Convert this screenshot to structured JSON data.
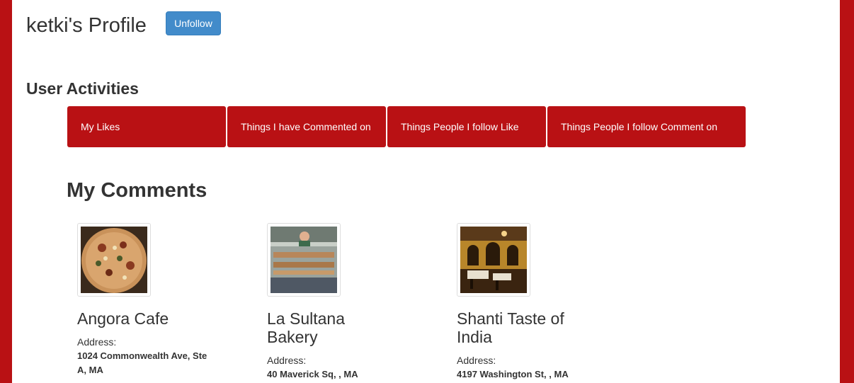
{
  "profile": {
    "title": "ketki's Profile",
    "unfollow_label": "Unfollow"
  },
  "activities": {
    "heading": "User Activities",
    "tabs": [
      {
        "label": "My Likes"
      },
      {
        "label": "Things I have Commented on"
      },
      {
        "label": "Things People I follow Like"
      },
      {
        "label": "Things People I follow Comment on"
      }
    ]
  },
  "comments": {
    "heading": "My Comments",
    "address_label": "Address:",
    "places": [
      {
        "name": "Angora Cafe",
        "address": "1024 Commonwealth Ave, Ste A, MA",
        "image": "pizza-photo"
      },
      {
        "name": "La Sultana Bakery",
        "address": "40 Maverick Sq, , MA",
        "image": "bakery-display-photo"
      },
      {
        "name": "Shanti Taste of India",
        "address": "4197 Washington St, , MA",
        "image": "restaurant-interior-photo"
      }
    ]
  },
  "colors": {
    "brand_red": "#b91114",
    "button_blue": "#428bca"
  }
}
